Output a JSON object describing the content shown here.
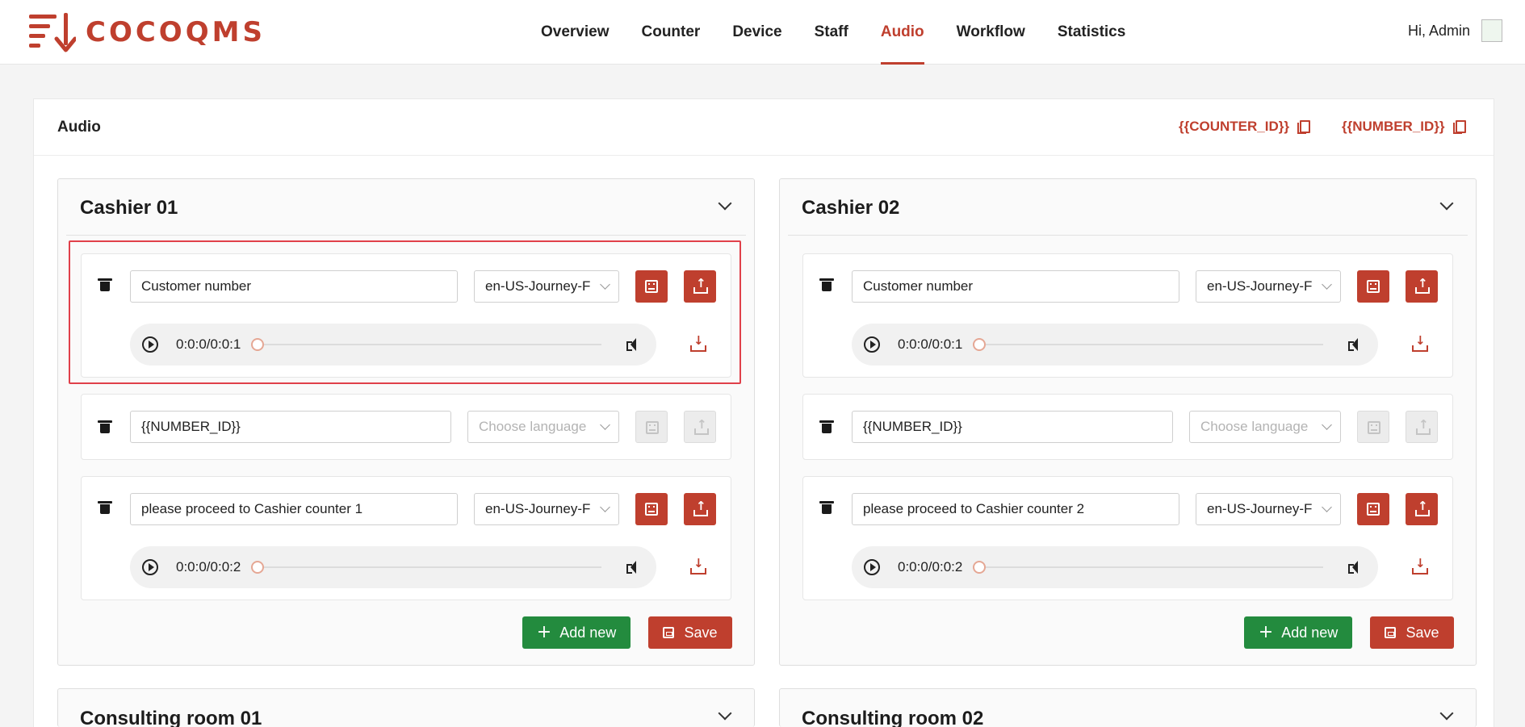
{
  "app": {
    "logo_text": "COCOQMS"
  },
  "nav": {
    "items": [
      {
        "label": "Overview"
      },
      {
        "label": "Counter"
      },
      {
        "label": "Device"
      },
      {
        "label": "Staff"
      },
      {
        "label": "Audio",
        "active": true
      },
      {
        "label": "Workflow"
      },
      {
        "label": "Statistics"
      }
    ]
  },
  "user": {
    "greeting": "Hi, Admin"
  },
  "page": {
    "title": "Audio",
    "variables": [
      "{{COUNTER_ID}}",
      "{{NUMBER_ID}}"
    ]
  },
  "colors": {
    "accent": "#bf3f2e",
    "success": "#238b3e",
    "highlight": "#e0404a"
  },
  "cards": [
    {
      "title": "Cashier 01",
      "items": [
        {
          "text": "Customer number",
          "language": "en-US-Journey-F",
          "has_audio": true,
          "time": "0:0:0/0:0:1"
        },
        {
          "text": "{{NUMBER_ID}}",
          "language_placeholder": "Choose language",
          "has_audio": false
        },
        {
          "text": "please proceed to Cashier counter 1",
          "language": "en-US-Journey-F",
          "has_audio": true,
          "time": "0:0:0/0:0:2"
        }
      ],
      "add_label": "Add new",
      "save_label": "Save"
    },
    {
      "title": "Cashier 02",
      "items": [
        {
          "text": "Customer number",
          "language": "en-US-Journey-F",
          "has_audio": true,
          "time": "0:0:0/0:0:1"
        },
        {
          "text": "{{NUMBER_ID}}",
          "language_placeholder": "Choose language",
          "has_audio": false
        },
        {
          "text": "please proceed to Cashier counter 2",
          "language": "en-US-Journey-F",
          "has_audio": true,
          "time": "0:0:0/0:0:2"
        }
      ],
      "add_label": "Add new",
      "save_label": "Save"
    },
    {
      "title": "Consulting room 01"
    },
    {
      "title": "Consulting room 02"
    }
  ]
}
